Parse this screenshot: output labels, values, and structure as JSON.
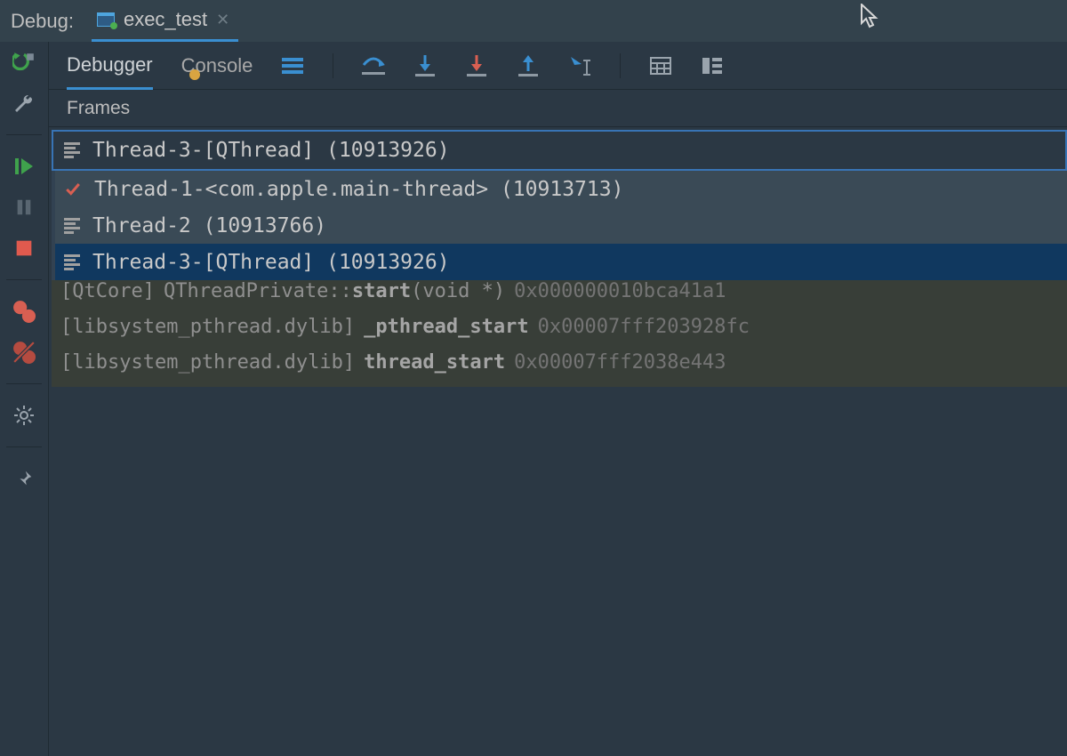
{
  "topbar": {
    "title": "Debug:",
    "tab_label": "exec_test"
  },
  "tabs": {
    "debugger": "Debugger",
    "console": "Console"
  },
  "panel": {
    "frames_header": "Frames"
  },
  "thread_selector": {
    "selected": "Thread-3-[QThread] (10913926)",
    "options": [
      {
        "label": "Thread-1-<com.apple.main-thread> (10913713)",
        "icon": "check"
      },
      {
        "label": "Thread-2 (10913766)",
        "icon": "stack"
      },
      {
        "label": "Thread-3-[QThread] (10913926)",
        "icon": "stack",
        "selected": true
      }
    ]
  },
  "frames": [
    {
      "module": "[QtCore]",
      "fn": "QThreadPrivate::",
      "fn_bold": "start",
      "sig": "(void *)",
      "addr": "0x000000010bca41a1"
    },
    {
      "module": "[libsystem_pthread.dylib]",
      "fn": "",
      "fn_bold": "_pthread_start",
      "sig": "",
      "addr": "0x00007fff203928fc"
    },
    {
      "module": "[libsystem_pthread.dylib]",
      "fn": "",
      "fn_bold": "thread_start",
      "sig": "",
      "addr": "0x00007fff2038e443"
    }
  ],
  "icons": {
    "gutter": [
      "rerun",
      "wrench",
      "resume",
      "pause",
      "stop",
      "breakpoints",
      "mute",
      "settings",
      "pin"
    ],
    "toolbar": [
      "threads",
      "step-over",
      "step-into",
      "force-step-into",
      "step-out",
      "run-to-cursor",
      "evaluate",
      "layout"
    ]
  }
}
